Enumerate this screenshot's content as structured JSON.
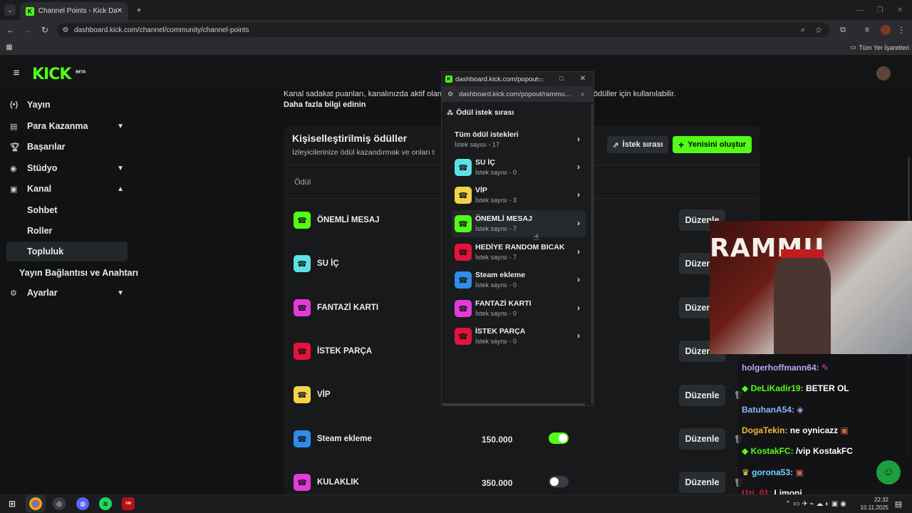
{
  "browser": {
    "tab_title": "Channel Points - Kick Dashboa",
    "url": "dashboard.kick.com/channel/community/channel-points",
    "bookmarks_label": "Tüm Yer İşaretleri"
  },
  "sidebar": {
    "logo": "KICK",
    "logo_badge": "BETA",
    "items": [
      {
        "label": "Yayın",
        "icon": "broadcast-icon"
      },
      {
        "label": "Para Kazanma",
        "icon": "monetize-icon"
      },
      {
        "label": "Başarılar",
        "icon": "trophy-icon"
      },
      {
        "label": "Stüdyo",
        "icon": "studio-icon"
      },
      {
        "label": "Kanal",
        "icon": "channel-icon"
      },
      {
        "label": "Sohbet"
      },
      {
        "label": "Roller"
      },
      {
        "label": "Topluluk"
      },
      {
        "label": "Yayın Bağlantısı ve Anahtarı"
      },
      {
        "label": "Ayarlar",
        "icon": "gear-icon"
      }
    ]
  },
  "main": {
    "intro_text_left": "Kanal sadakat puanları, kanalınızda aktif olan",
    "intro_text_right": "ödüller için kullanılabilir.",
    "learn_more": "Daha fazla bilgi edinin",
    "section_title": "Kişiselleştirilmiş ödüller",
    "section_subtitle": "İzleyicilerinize ödül kazandırmak ve onları t",
    "queue_button": "İstek sırası",
    "create_button": "Yenisini oluştur",
    "col_reward": "Ödül",
    "edit_label": "Düzenle",
    "rewards": [
      {
        "name": "ÖNEMLİ MESAJ",
        "color": "#53fc18"
      },
      {
        "name": "SU İÇ",
        "color": "#5ee0e6"
      },
      {
        "name": "FANTAZİ KARTI",
        "color": "#e23bd8"
      },
      {
        "name": "İSTEK PARÇA",
        "color": "#e3143c"
      },
      {
        "name": "VİP",
        "color": "#f2d34a"
      },
      {
        "name": "Steam ekleme",
        "color": "#2f8ce8",
        "cost": "150.000",
        "enabled": true
      },
      {
        "name": "KULAKLIK",
        "color": "#e23bd8",
        "cost": "350.000",
        "enabled": false
      }
    ]
  },
  "popout": {
    "title": "dashboard.kick.com/popout...",
    "url": "dashboard.kick.com/popout/rammu...",
    "header": "Ödül istek sırası",
    "all_label": "Tüm ödül istekleri",
    "all_count": "İstek sayısı - 17",
    "queue": [
      {
        "name": "SU İÇ",
        "count": "İstek sayısı - 0",
        "color": "#5ee0e6"
      },
      {
        "name": "VİP",
        "count": "İstek sayısı - 3",
        "color": "#f2d34a"
      },
      {
        "name": "ÖNEMLİ MESAJ",
        "count": "İstek sayısı - 7",
        "color": "#53fc18"
      },
      {
        "name": "HEDİYE RANDOM BICAK",
        "count": "İstek sayısı - 7",
        "color": "#e3143c"
      },
      {
        "name": "Steam ekleme",
        "count": "İstek sayısı - 0",
        "color": "#2f8ce8"
      },
      {
        "name": "FANTAZİ KARTI",
        "count": "İstek sayısı - 0",
        "color": "#e23bd8"
      },
      {
        "name": "İSTEK PARÇA",
        "count": "İstek sayısı - 0",
        "color": "#e3143c"
      }
    ]
  },
  "stream": {
    "overlay_text": "RAMMU",
    "chat": [
      {
        "user": "holgerhoffmann64:",
        "msg": "",
        "color": "#b6a6f5"
      },
      {
        "user": "DeLiKadir19:",
        "msg": "BETER OL",
        "color": "#53fc18"
      },
      {
        "user": "BatuhanA54:",
        "msg": "",
        "color": "#8fb4ff"
      },
      {
        "user": "DogaTekin:",
        "msg": "ne oynicazz",
        "color": "#f2b83a"
      },
      {
        "user": "KostakFC:",
        "msg": "/vip KostakFC",
        "color": "#53fc18"
      },
      {
        "user": "gorona53:",
        "msg": "",
        "color": "#6ad4ff"
      },
      {
        "user": "Uzi_01:",
        "msg": "Limoni",
        "color": "#e3143c"
      }
    ]
  },
  "taskbar": {
    "time": "22:32",
    "date": "10.11.2025"
  }
}
